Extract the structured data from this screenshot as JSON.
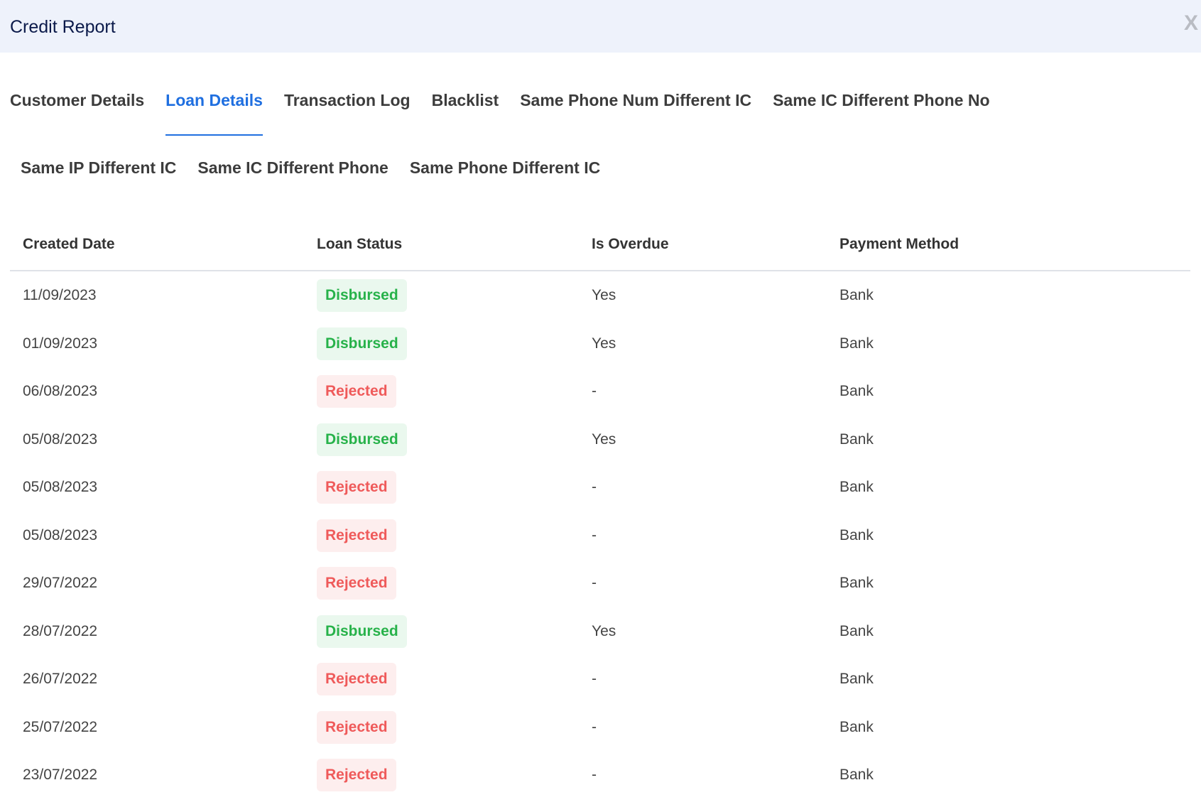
{
  "modal": {
    "title": "Credit Report",
    "close_label": "X"
  },
  "tabs_row1": [
    {
      "label": "Customer Details",
      "active": false
    },
    {
      "label": "Loan Details",
      "active": true
    },
    {
      "label": "Transaction Log",
      "active": false
    },
    {
      "label": "Blacklist",
      "active": false
    },
    {
      "label": "Same Phone Num Different IC",
      "active": false
    },
    {
      "label": "Same IC Different Phone No",
      "active": false
    }
  ],
  "tabs_row2": [
    {
      "label": "Same IP Different IC",
      "active": false
    },
    {
      "label": "Same IC Different Phone",
      "active": false
    },
    {
      "label": "Same Phone Different IC",
      "active": false
    }
  ],
  "table": {
    "headers": [
      "Created Date",
      "Loan Status",
      "Is Overdue",
      "Payment Method"
    ],
    "rows": [
      {
        "date": "11/09/2023",
        "status": "Disbursed",
        "overdue": "Yes",
        "method": "Bank"
      },
      {
        "date": "01/09/2023",
        "status": "Disbursed",
        "overdue": "Yes",
        "method": "Bank"
      },
      {
        "date": "06/08/2023",
        "status": "Rejected",
        "overdue": "-",
        "method": "Bank"
      },
      {
        "date": "05/08/2023",
        "status": "Disbursed",
        "overdue": "Yes",
        "method": "Bank"
      },
      {
        "date": "05/08/2023",
        "status": "Rejected",
        "overdue": "-",
        "method": "Bank"
      },
      {
        "date": "05/08/2023",
        "status": "Rejected",
        "overdue": "-",
        "method": "Bank"
      },
      {
        "date": "29/07/2022",
        "status": "Rejected",
        "overdue": "-",
        "method": "Bank"
      },
      {
        "date": "28/07/2022",
        "status": "Disbursed",
        "overdue": "Yes",
        "method": "Bank"
      },
      {
        "date": "26/07/2022",
        "status": "Rejected",
        "overdue": "-",
        "method": "Bank"
      },
      {
        "date": "25/07/2022",
        "status": "Rejected",
        "overdue": "-",
        "method": "Bank"
      },
      {
        "date": "23/07/2022",
        "status": "Rejected",
        "overdue": "-",
        "method": "Bank"
      }
    ]
  },
  "colors": {
    "accent": "#1f6fe0",
    "header_bg": "#eef2fb",
    "disbursed_text": "#27b24a",
    "disbursed_bg": "#eaf8ee",
    "rejected_text": "#ef5a5a",
    "rejected_bg": "#fdeeee"
  }
}
